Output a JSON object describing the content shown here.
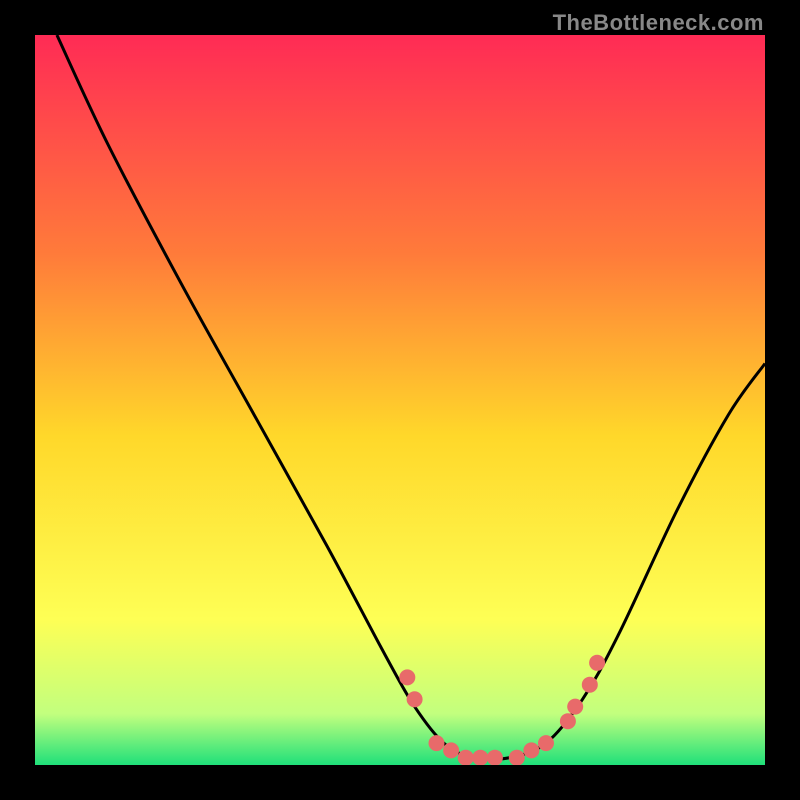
{
  "watermark": "TheBottleneck.com",
  "chart_data": {
    "type": "line",
    "title": "",
    "xlabel": "",
    "ylabel": "",
    "xlim": [
      0,
      100
    ],
    "ylim": [
      0,
      100
    ],
    "background_gradient": {
      "top": "#ff2b55",
      "mid_upper": "#ff7b3a",
      "mid": "#ffd82a",
      "mid_lower": "#feff55",
      "lower": "#c2ff7e",
      "bottom": "#1fe07a"
    },
    "curve": {
      "description": "V-shaped curve with minimum near x=62",
      "points": [
        {
          "x": 3,
          "y": 100
        },
        {
          "x": 10,
          "y": 85
        },
        {
          "x": 20,
          "y": 66
        },
        {
          "x": 30,
          "y": 48
        },
        {
          "x": 40,
          "y": 30
        },
        {
          "x": 48,
          "y": 15
        },
        {
          "x": 52,
          "y": 8
        },
        {
          "x": 56,
          "y": 3
        },
        {
          "x": 60,
          "y": 1
        },
        {
          "x": 65,
          "y": 1
        },
        {
          "x": 70,
          "y": 3
        },
        {
          "x": 75,
          "y": 9
        },
        {
          "x": 80,
          "y": 18
        },
        {
          "x": 88,
          "y": 35
        },
        {
          "x": 95,
          "y": 48
        },
        {
          "x": 100,
          "y": 55
        }
      ]
    },
    "markers": {
      "color": "#e86a6a",
      "points": [
        {
          "x": 51,
          "y": 12
        },
        {
          "x": 52,
          "y": 9
        },
        {
          "x": 55,
          "y": 3
        },
        {
          "x": 57,
          "y": 2
        },
        {
          "x": 59,
          "y": 1
        },
        {
          "x": 61,
          "y": 1
        },
        {
          "x": 63,
          "y": 1
        },
        {
          "x": 66,
          "y": 1
        },
        {
          "x": 68,
          "y": 2
        },
        {
          "x": 70,
          "y": 3
        },
        {
          "x": 73,
          "y": 6
        },
        {
          "x": 74,
          "y": 8
        },
        {
          "x": 76,
          "y": 11
        },
        {
          "x": 77,
          "y": 14
        }
      ]
    }
  }
}
